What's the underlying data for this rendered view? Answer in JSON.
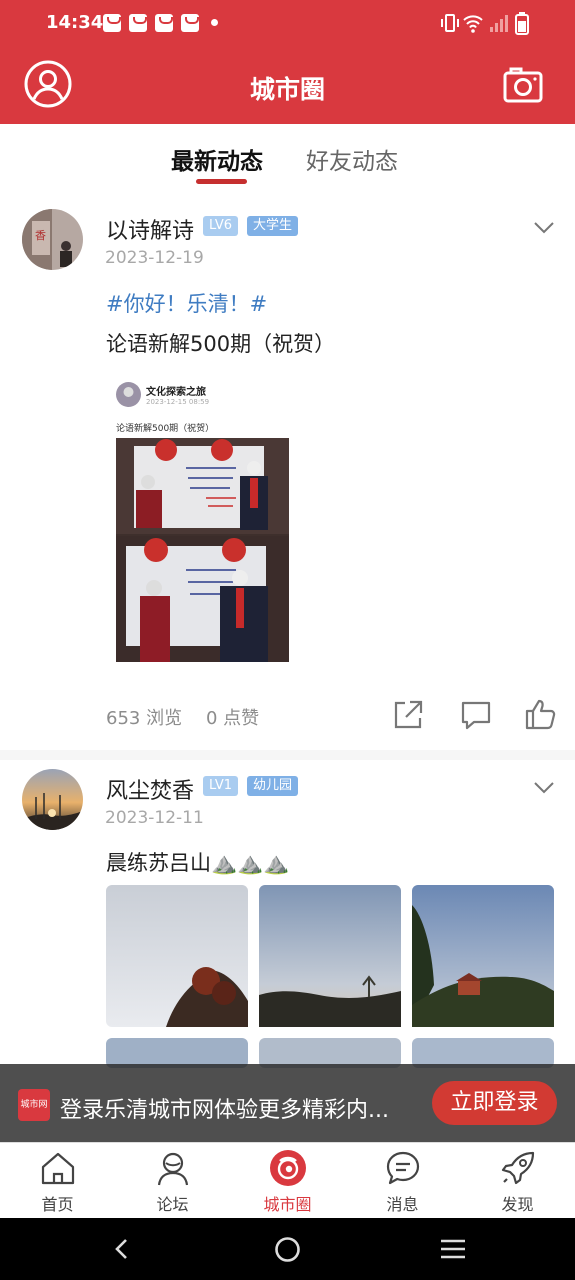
{
  "status_bar": {
    "time": "14:34"
  },
  "header": {
    "title": "城市圈",
    "profile_icon": "user-circle-icon",
    "camera_icon": "camera-icon"
  },
  "tabs": [
    {
      "label": "最新动态",
      "active": true
    },
    {
      "label": "好友动态",
      "active": false
    }
  ],
  "posts": [
    {
      "user": "以诗解诗",
      "level": "LV6",
      "role": "大学生",
      "date": "2023-12-19",
      "topic": "#你好！乐清！#",
      "text": "论语新解500期（祝贺）",
      "embedded": {
        "account": "文化探索之旅",
        "date": "2023-12-15 08:59",
        "caption": "论语新解500期（祝贺）"
      },
      "views": "653 浏览",
      "likes": "0 点赞"
    },
    {
      "user": "风尘焚香",
      "level": "LV1",
      "role": "幼儿园",
      "date": "2023-12-11",
      "text": "晨练苏吕山⛰️⛰️⛰️"
    }
  ],
  "login_banner": {
    "logo_text": "城市网",
    "message": "登录乐清城市网体验更多精彩内...",
    "button": "立即登录"
  },
  "bottom_nav": [
    {
      "label": "首页",
      "icon": "home-icon",
      "active": false
    },
    {
      "label": "论坛",
      "icon": "forum-icon",
      "active": false
    },
    {
      "label": "城市圈",
      "icon": "city-circle-icon",
      "active": true
    },
    {
      "label": "消息",
      "icon": "message-icon",
      "active": false
    },
    {
      "label": "发现",
      "icon": "rocket-icon",
      "active": false
    }
  ],
  "colors": {
    "brand": "#d9393f",
    "topic": "#3f7cc2"
  }
}
